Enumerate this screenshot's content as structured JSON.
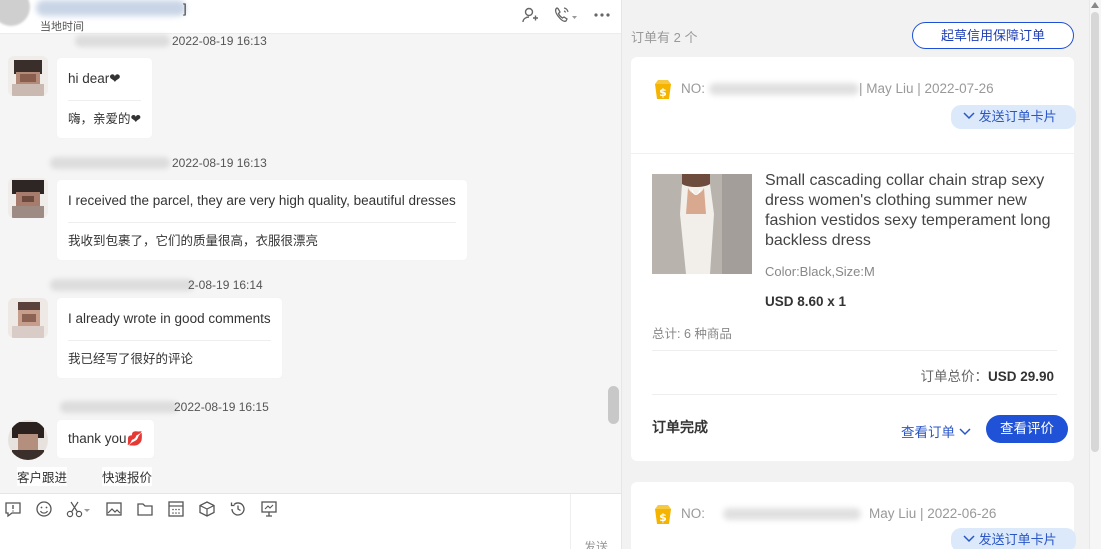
{
  "chat": {
    "header": {
      "bracket": "]",
      "local_time_label": "当地时间",
      "icons": [
        "add-user-icon",
        "phone-icon",
        "more-icon"
      ]
    },
    "messages": [
      {
        "time": "2022-08-19 16:13",
        "text_en": "hi dear❤",
        "text_zh": "嗨，亲爱的❤"
      },
      {
        "time": "2022-08-19 16:13",
        "text_en": "I received the parcel, they are very high quality, beautiful dresses",
        "text_zh": "我收到包裹了，它们的质量很高，衣服很漂亮"
      },
      {
        "time": "2-08-19 16:14",
        "text_en": "I already wrote in good comments",
        "text_zh": "我已经写了很好的评论"
      },
      {
        "time": "2022-08-19 16:15",
        "text_en": "thank you💋",
        "text_zh": ""
      }
    ],
    "quick_actions": [
      "客户跟进",
      "快速报价"
    ],
    "toolbar_icons": [
      "feedback-icon",
      "emoji-icon",
      "scissors-icon",
      "image-icon",
      "folder-icon",
      "calculator-icon",
      "package-icon",
      "history-icon",
      "screen-icon"
    ],
    "send_label": "发送"
  },
  "orders": {
    "count_label": "订单有 2 个",
    "draft_button": "起草信用保障订单",
    "list": [
      {
        "no_label": "NO:",
        "buyer": "| May Liu | 2022-07-26",
        "send_card": "发送订单卡片",
        "product": {
          "title": "Small cascading collar chain strap sexy dress women's clothing summer new fashion vestidos sexy temperament long backless dress",
          "spec": "Color:Black,Size:M",
          "price": "USD 8.60 x 1"
        },
        "total_items": "总计: 6 种商品",
        "total_label": "订单总价：",
        "total_value": "USD 29.90",
        "status": "订单完成",
        "view_order": "查看订单",
        "view_review": "查看评价"
      },
      {
        "no_label": "NO:",
        "buyer": "May Liu | 2022-06-26",
        "send_card": "发送订单卡片"
      }
    ]
  },
  "colors": {
    "accent": "#1f52d6",
    "chip_bg": "#dbe9fb",
    "coin": "#f5b400"
  }
}
